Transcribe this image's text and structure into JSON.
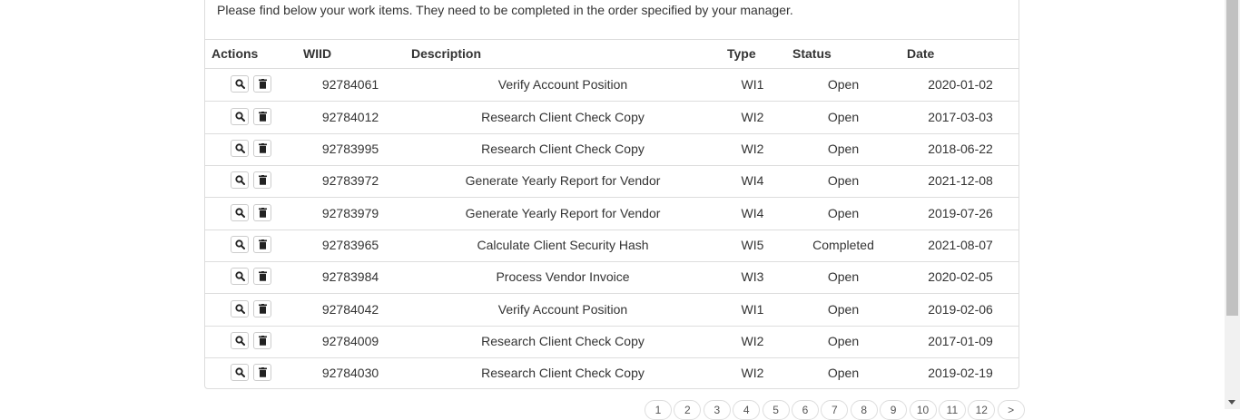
{
  "intro_text": "Please find below your work items. They need to be completed in the order specified by your manager.",
  "table": {
    "headers": {
      "actions": "Actions",
      "wiid": "WIID",
      "description": "Description",
      "type": "Type",
      "status": "Status",
      "date": "Date"
    },
    "rows": [
      {
        "wiid": "92784061",
        "description": "Verify Account Position",
        "type": "WI1",
        "status": "Open",
        "date": "2020-01-02"
      },
      {
        "wiid": "92784012",
        "description": "Research Client Check Copy",
        "type": "WI2",
        "status": "Open",
        "date": "2017-03-03"
      },
      {
        "wiid": "92783995",
        "description": "Research Client Check Copy",
        "type": "WI2",
        "status": "Open",
        "date": "2018-06-22"
      },
      {
        "wiid": "92783972",
        "description": "Generate Yearly Report for Vendor",
        "type": "WI4",
        "status": "Open",
        "date": "2021-12-08"
      },
      {
        "wiid": "92783979",
        "description": "Generate Yearly Report for Vendor",
        "type": "WI4",
        "status": "Open",
        "date": "2019-07-26"
      },
      {
        "wiid": "92783965",
        "description": "Calculate Client Security Hash",
        "type": "WI5",
        "status": "Completed",
        "date": "2021-08-07"
      },
      {
        "wiid": "92783984",
        "description": "Process Vendor Invoice",
        "type": "WI3",
        "status": "Open",
        "date": "2020-02-05"
      },
      {
        "wiid": "92784042",
        "description": "Verify Account Position",
        "type": "WI1",
        "status": "Open",
        "date": "2019-02-06"
      },
      {
        "wiid": "92784009",
        "description": "Research Client Check Copy",
        "type": "WI2",
        "status": "Open",
        "date": "2017-01-09"
      },
      {
        "wiid": "92784030",
        "description": "Research Client Check Copy",
        "type": "WI2",
        "status": "Open",
        "date": "2019-02-19"
      }
    ]
  },
  "actions": {
    "view_icon": "magnifier-icon",
    "delete_icon": "trash-icon"
  },
  "pagination": [
    "1",
    "2",
    "3",
    "4",
    "5",
    "6",
    "7",
    "8",
    "9",
    "10",
    "11",
    "12",
    ">"
  ]
}
